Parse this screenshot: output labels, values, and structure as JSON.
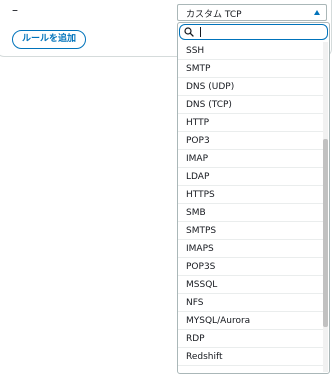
{
  "rule_row": {
    "dash": "–",
    "add_rule_label": "ルールを追加"
  },
  "type_select": {
    "value": "カスタム TCP",
    "search": {
      "value": "",
      "placeholder": ""
    },
    "options": [
      "SSH",
      "SMTP",
      "DNS (UDP)",
      "DNS (TCP)",
      "HTTP",
      "POP3",
      "IMAP",
      "LDAP",
      "HTTPS",
      "SMB",
      "SMTPS",
      "IMAPS",
      "POP3S",
      "MSSQL",
      "NFS",
      "MYSQL/Aurora",
      "RDP",
      "Redshift"
    ]
  },
  "colors": {
    "accent": "#0073bb",
    "border": "#aab7b8",
    "text": "#16191f",
    "divider": "#eaeded"
  },
  "icons": {
    "search": "search-icon",
    "caret": "caret-up-icon"
  }
}
